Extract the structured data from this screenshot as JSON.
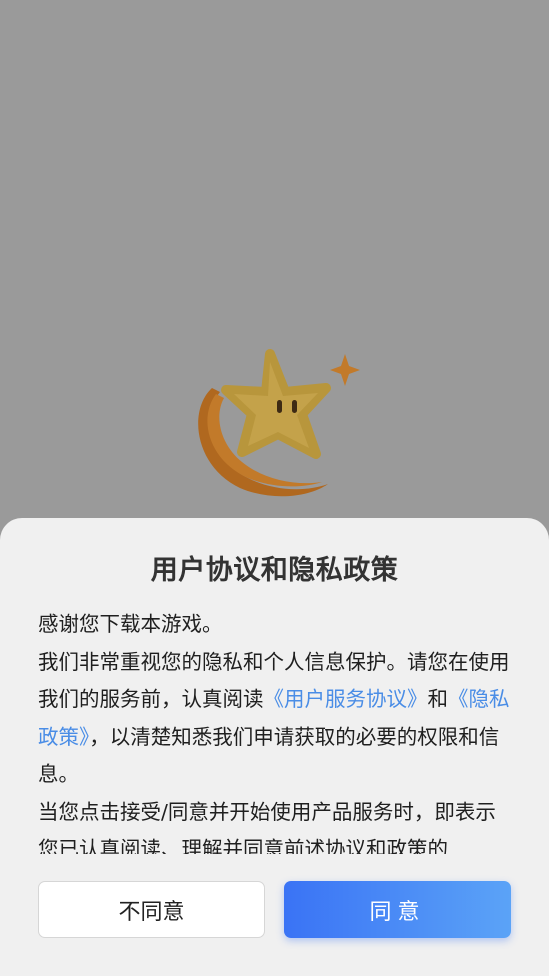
{
  "dialog": {
    "title": "用户协议和隐私政策",
    "paragraph1": "感谢您下载本游戏。",
    "paragraph2_before": "我们非常重视您的隐私和个人信息保护。请您在使用我们的服务前，认真阅读",
    "user_agreement_link": "《用户服务协议》",
    "and_text": "和",
    "privacy_policy_link": "《隐私政策》",
    "paragraph2_after": "，以清楚知悉我们申请获取的必要的权限和信息。",
    "paragraph3": "当您点击接受/同意并开始使用产品服务时，即表示您已认真阅读、理解并同意前述协议和政策的",
    "decline_label": "不同意",
    "accept_label": "同意"
  },
  "colors": {
    "backdrop": "#9a9a9a",
    "sheet": "#f0f0f0",
    "link": "#4a8de6",
    "accept_gradient_start": "#3a73f5",
    "accept_gradient_end": "#5ba3f7"
  },
  "logo": {
    "icon": "star-mascot-logo"
  }
}
